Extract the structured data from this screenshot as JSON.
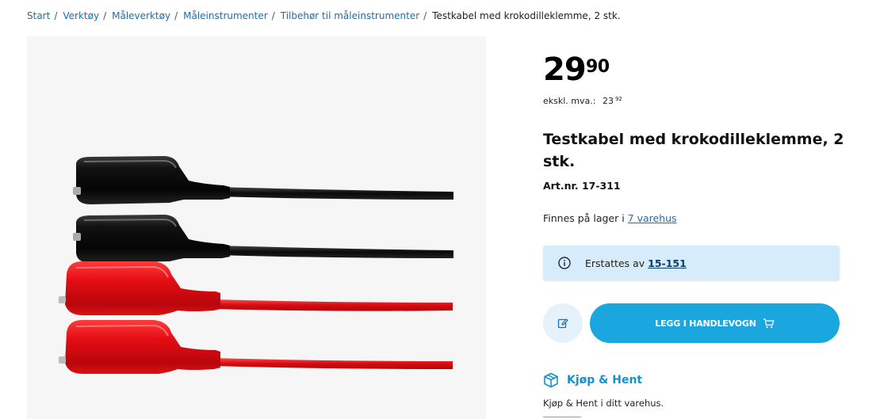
{
  "breadcrumb": {
    "items": [
      "Start",
      "Verktøy",
      "Måleverktøy",
      "Måleinstrumenter",
      "Tilbehør til måleinstrumenter"
    ],
    "current": "Testkabel med krokodilleklemme, 2 stk.",
    "separator": "/"
  },
  "product": {
    "image_alt": "Testkabel med krokodilleklemme",
    "price_whole": "29",
    "price_decimals": "90",
    "ex_vat_label": "ekskl. mva.:",
    "ex_vat_whole": "23",
    "ex_vat_decimals": "92",
    "title": "Testkabel med krokodilleklemme, 2 stk.",
    "art_nr": "Art.nr. 17-311"
  },
  "stock": {
    "prefix": "Finnes på lager i",
    "link": "7 varehus"
  },
  "notice": {
    "icon": "info-icon",
    "text": "Erstattes av",
    "link": "15-151"
  },
  "actions": {
    "edit_icon": "edit-icon",
    "cart_label": "LEGG I HANDLEVOGN",
    "cart_icon": "cart-icon"
  },
  "kjop_hent": {
    "icon": "box-icon",
    "title": "Kjøp & Hent",
    "text": "Kjøp & Hent i ditt varehus."
  },
  "colors": {
    "accent": "#1aa7df",
    "link": "#1a6fb3",
    "notice_bg": "#d6ecfa",
    "edit_bg": "#e5f2fb",
    "image_bg": "#f6f6f6"
  }
}
